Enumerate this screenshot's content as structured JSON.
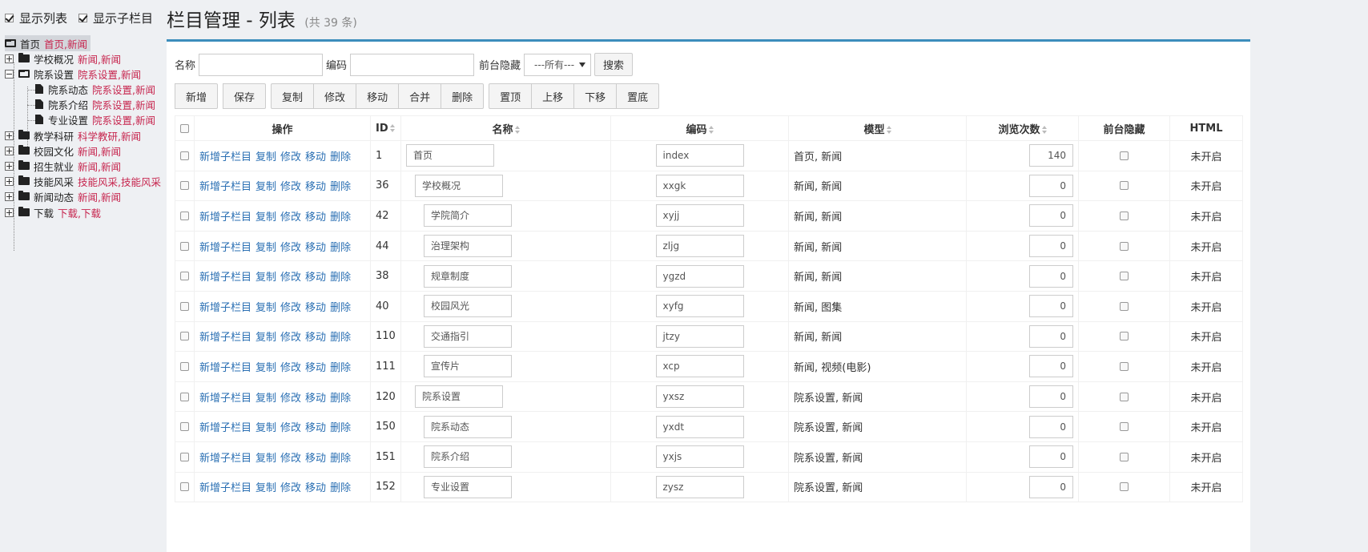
{
  "sidebar": {
    "toggles": [
      {
        "label": "显示列表",
        "checked": true
      },
      {
        "label": "显示子栏目",
        "checked": true
      }
    ],
    "tree": [
      {
        "label": "首页",
        "tags": "首页,新闻",
        "selected": true
      },
      {
        "label": "学校概况",
        "tags": "新闻,新闻"
      },
      {
        "label": "院系设置",
        "tags": "院系设置,新闻"
      },
      {
        "label": "院系动态",
        "tags": "院系设置,新闻"
      },
      {
        "label": "院系介绍",
        "tags": "院系设置,新闻"
      },
      {
        "label": "专业设置",
        "tags": "院系设置,新闻"
      },
      {
        "label": "教学科研",
        "tags": "科学教研,新闻"
      },
      {
        "label": "校园文化",
        "tags": "新闻,新闻"
      },
      {
        "label": "招生就业",
        "tags": "新闻,新闻"
      },
      {
        "label": "技能风采",
        "tags": "技能风采,技能风采"
      },
      {
        "label": "新闻动态",
        "tags": "新闻,新闻"
      },
      {
        "label": "下载",
        "tags": "下载,下载"
      }
    ]
  },
  "header": {
    "title": "栏目管理 - 列表",
    "count": "(共 39 条)"
  },
  "filter": {
    "name_label": "名称",
    "code_label": "编码",
    "hidden_label": "前台隐藏",
    "hidden_value": "---所有---",
    "search_label": "搜索"
  },
  "toolbar": {
    "add": "新增",
    "save": "保存",
    "copy": "复制",
    "edit": "修改",
    "move": "移动",
    "merge": "合并",
    "delete": "删除",
    "top": "置顶",
    "up": "上移",
    "down": "下移",
    "bottom": "置底"
  },
  "table": {
    "headers": {
      "ops": "操作",
      "id": "ID",
      "name": "名称",
      "code": "编码",
      "model": "模型",
      "views": "浏览次数",
      "hidden": "前台隐藏",
      "html": "HTML"
    },
    "op_links": [
      "新增子栏目",
      "复制",
      "修改",
      "移动",
      "删除"
    ],
    "rows": [
      {
        "id": "1",
        "name": "首页",
        "code": "index",
        "model": "首页, 新闻",
        "views": "140",
        "html": "未开启"
      },
      {
        "id": "36",
        "name": "学校概况",
        "code": "xxgk",
        "model": "新闻, 新闻",
        "views": "0",
        "html": "未开启"
      },
      {
        "id": "42",
        "name": "学院简介",
        "code": "xyjj",
        "model": "新闻, 新闻",
        "views": "0",
        "html": "未开启"
      },
      {
        "id": "44",
        "name": "治理架构",
        "code": "zljg",
        "model": "新闻, 新闻",
        "views": "0",
        "html": "未开启"
      },
      {
        "id": "38",
        "name": "规章制度",
        "code": "ygzd",
        "model": "新闻, 新闻",
        "views": "0",
        "html": "未开启"
      },
      {
        "id": "40",
        "name": "校园风光",
        "code": "xyfg",
        "model": "新闻, 图集",
        "views": "0",
        "html": "未开启"
      },
      {
        "id": "110",
        "name": "交通指引",
        "code": "jtzy",
        "model": "新闻, 新闻",
        "views": "0",
        "html": "未开启"
      },
      {
        "id": "111",
        "name": "宣传片",
        "code": "xcp",
        "model": "新闻, 视频(电影)",
        "views": "0",
        "html": "未开启"
      },
      {
        "id": "120",
        "name": "院系设置",
        "code": "yxsz",
        "model": "院系设置, 新闻",
        "views": "0",
        "html": "未开启"
      },
      {
        "id": "150",
        "name": "院系动态",
        "code": "yxdt",
        "model": "院系设置, 新闻",
        "views": "0",
        "html": "未开启"
      },
      {
        "id": "151",
        "name": "院系介绍",
        "code": "yxjs",
        "model": "院系设置, 新闻",
        "views": "0",
        "html": "未开启"
      },
      {
        "id": "152",
        "name": "专业设置",
        "code": "zysz",
        "model": "院系设置, 新闻",
        "views": "0",
        "html": "未开启"
      }
    ]
  }
}
